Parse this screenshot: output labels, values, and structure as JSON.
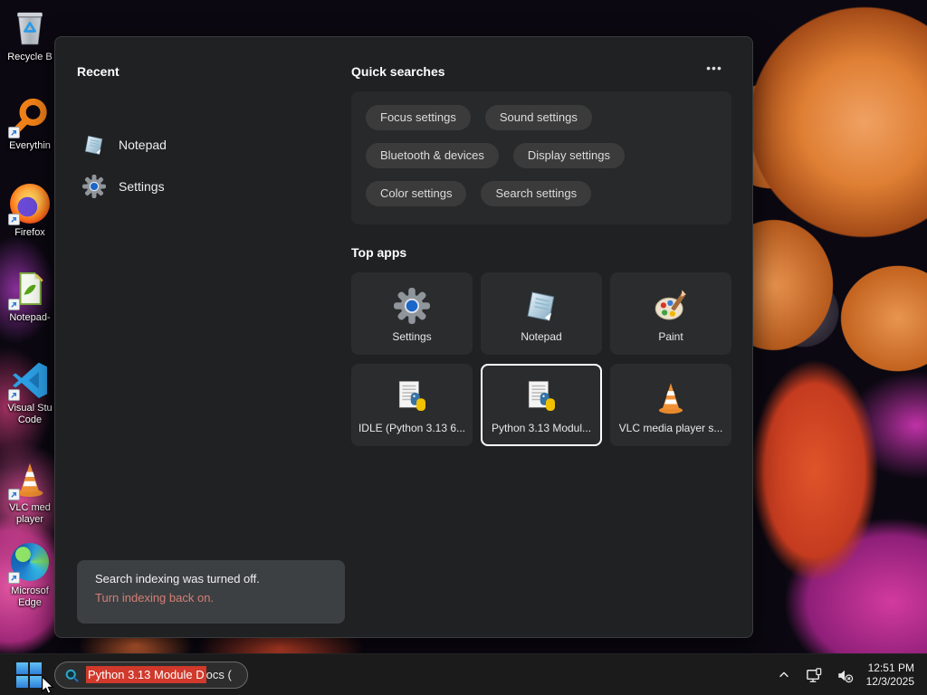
{
  "desktop": {
    "icons": [
      {
        "name": "recycle-bin",
        "label": "Recycle B"
      },
      {
        "name": "everything",
        "label": "Everythin"
      },
      {
        "name": "firefox",
        "label": "Firefox"
      },
      {
        "name": "notepad-plus-plus",
        "label": "Notepad-"
      },
      {
        "name": "visual-studio-code",
        "label": "Visual Stu Code"
      },
      {
        "name": "vlc-media-player",
        "label": "VLC med player"
      },
      {
        "name": "microsoft-edge",
        "label": "Microsof Edge"
      }
    ]
  },
  "search_panel": {
    "recent": {
      "title": "Recent",
      "items": [
        {
          "label": "Notepad",
          "icon": "notepad-icon"
        },
        {
          "label": "Settings",
          "icon": "gear-icon"
        }
      ]
    },
    "quick_searches": {
      "title": "Quick searches",
      "pills": [
        "Focus settings",
        "Sound settings",
        "Bluetooth & devices",
        "Display settings",
        "Color settings",
        "Search settings"
      ]
    },
    "top_apps": {
      "title": "Top apps",
      "tiles": [
        {
          "label": "Settings",
          "icon": "gear-icon",
          "selected": false
        },
        {
          "label": "Notepad",
          "icon": "notepad-icon",
          "selected": false
        },
        {
          "label": "Paint",
          "icon": "paint-palette-icon",
          "selected": false
        },
        {
          "label": "IDLE (Python 3.13 6...",
          "icon": "python-doc-icon",
          "selected": false
        },
        {
          "label": "Python 3.13 Modul...",
          "icon": "python-doc-icon",
          "selected": true
        },
        {
          "label": "VLC media player s...",
          "icon": "traffic-cone-icon",
          "selected": false
        }
      ]
    },
    "indexing_notice": {
      "line1": "Search indexing was turned off.",
      "line2": "Turn indexing back on."
    }
  },
  "taskbar": {
    "search": {
      "highlighted_text": "Python 3.13 Module D",
      "rest_text": "ocs ("
    },
    "tray": {
      "time": "12:51 PM",
      "date": "12/3/2025"
    }
  },
  "icons": {
    "ellipsis": "•••"
  },
  "colors": {
    "panel_bg": "#202122",
    "taskbar_bg": "#1b1b1c",
    "selection_red": "#d0392b",
    "notice_link": "#d47f76",
    "tile_selected_border": "#ffffff"
  }
}
